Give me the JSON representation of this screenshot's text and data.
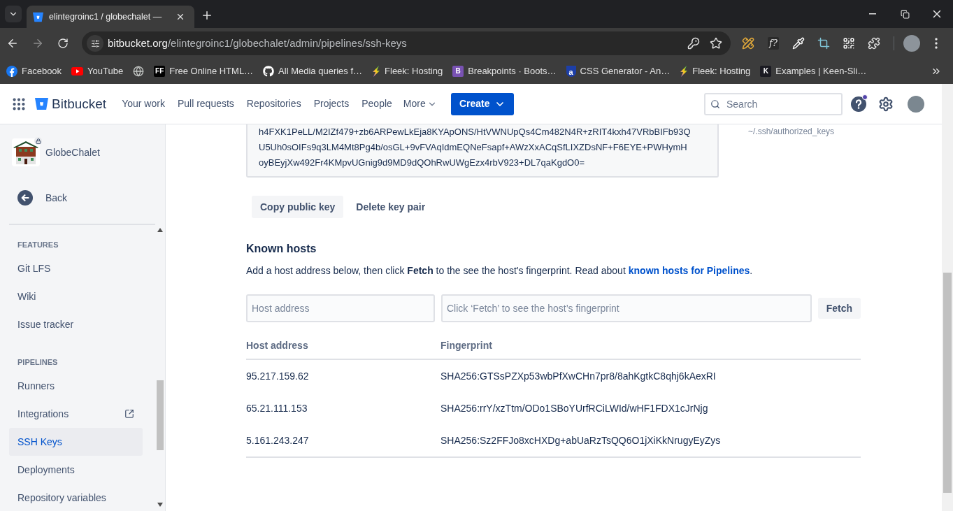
{
  "browser": {
    "tab": {
      "title": "elintegroinc1 / globechalet —"
    },
    "address": {
      "host": "bitbucket.org",
      "path": "/elintegroinc1/globechalet/admin/pipelines/ssh-keys"
    },
    "extensions": [
      {
        "kind": "pencil-ruler"
      },
      {
        "kind": "function",
        "badge": "f?"
      },
      {
        "kind": "eyedropper"
      },
      {
        "kind": "crop"
      },
      {
        "kind": "qr"
      },
      {
        "kind": "puzzle"
      }
    ],
    "bookmarks": [
      {
        "kind": "facebook",
        "label": "Facebook"
      },
      {
        "kind": "youtube",
        "label": "YouTube"
      },
      {
        "kind": "globe"
      },
      {
        "kind": "letter",
        "badge": "FF",
        "color": "#000000",
        "label": "Free Online HTML…"
      },
      {
        "kind": "github",
        "label": "All Media queries f…"
      },
      {
        "kind": "bolt",
        "label": "Fleek: Hosting"
      },
      {
        "kind": "letter",
        "badge": "B",
        "color": "#7952b3",
        "label": "Breakpoints · Boots…"
      },
      {
        "kind": "drop",
        "badge": "a",
        "color": "#1d3fa8",
        "label": "CSS Generator - An…"
      },
      {
        "kind": "bolt",
        "label": "Fleek: Hosting"
      },
      {
        "kind": "letter",
        "badge": "K",
        "color": "#1b1b22",
        "label": "Examples | Keen-Sli…"
      }
    ]
  },
  "header": {
    "product": "Bitbucket",
    "nav": [
      {
        "label": "Your work",
        "kind": "link"
      },
      {
        "label": "Pull requests",
        "kind": "link"
      },
      {
        "label": "Repositories",
        "kind": "link"
      },
      {
        "label": "Projects",
        "kind": "link"
      },
      {
        "label": "People",
        "kind": "link"
      },
      {
        "label": "More",
        "kind": "menu"
      }
    ],
    "create_button": "Create",
    "search": {
      "placeholder": "Search"
    }
  },
  "sidebar": {
    "repo": {
      "name": "GlobeChalet",
      "private": true
    },
    "back": "Back",
    "sections": [
      {
        "heading": "FEATURES",
        "items": [
          {
            "label": "Git LFS",
            "external": false,
            "selected": false
          },
          {
            "label": "Wiki",
            "external": false,
            "selected": false
          },
          {
            "label": "Issue tracker",
            "external": false,
            "selected": false
          }
        ]
      },
      {
        "heading": "PIPELINES",
        "items": [
          {
            "label": "Runners",
            "external": false,
            "selected": false
          },
          {
            "label": "Integrations",
            "external": true,
            "selected": false
          },
          {
            "label": "SSH Keys",
            "external": false,
            "selected": true
          },
          {
            "label": "Deployments",
            "external": false,
            "selected": false
          },
          {
            "label": "Repository variables",
            "external": false,
            "selected": false
          }
        ]
      }
    ]
  },
  "content": {
    "public_key": {
      "lines": [
        "h4FXK1PeLL/M2IZf479+zb6ARPewLkEja8KYApONS/HtVWNUpQs4Cm482N4R+zRIT4kxh47VRbBIFb93Q",
        "U5Uh0sOIFs9q3LM4Mt8Pg4b/osGL+9vFVAqIdmEQNeFsapf+AWzXxACqSfLIXZDsNF+F6EYE+PWHymH",
        "oyBEyjXw492Fr4KMpvUGnig9d9MD9dQOhRwUWgEzx4rbV923+DL7qaKgdO0="
      ]
    },
    "key_location": "~/.ssh/authorized_keys",
    "actions": [
      {
        "label": "Copy public key",
        "kind": "default"
      },
      {
        "label": "Delete key pair",
        "kind": "subtle"
      }
    ],
    "known_hosts": {
      "title": "Known hosts",
      "description": {
        "text": "Add a host address below, then click **Fetch** to the see the host's fingerprint. Read about",
        "link": "known hosts for Pipelines",
        "after": "."
      },
      "host_field": {
        "placeholder": "Host address"
      },
      "fingerprint_field": {
        "placeholder": "Click ‘Fetch’ to see the host’s fingerprint"
      },
      "fetch_button": "Fetch",
      "table": {
        "columns": [
          "Host address",
          "Fingerprint"
        ],
        "rows": [
          {
            "host": "95.217.159.62",
            "fingerprint": "SHA256:GTSsPZXp53wbPfXwCHn7pr8/8ahKgtkC8qhj6kAexRI"
          },
          {
            "host": "65.21.111.153",
            "fingerprint": "SHA256:rrY/xzTtm/ODo1SBoYUrfRCiLWId/wHF1FDX1cJrNjg"
          },
          {
            "host": "5.161.243.247",
            "fingerprint": "SHA256:Sz2FFJo8xcHXDg+abUaRzTsQQ6O1jXiKkNrugyEyZys"
          }
        ]
      }
    }
  }
}
